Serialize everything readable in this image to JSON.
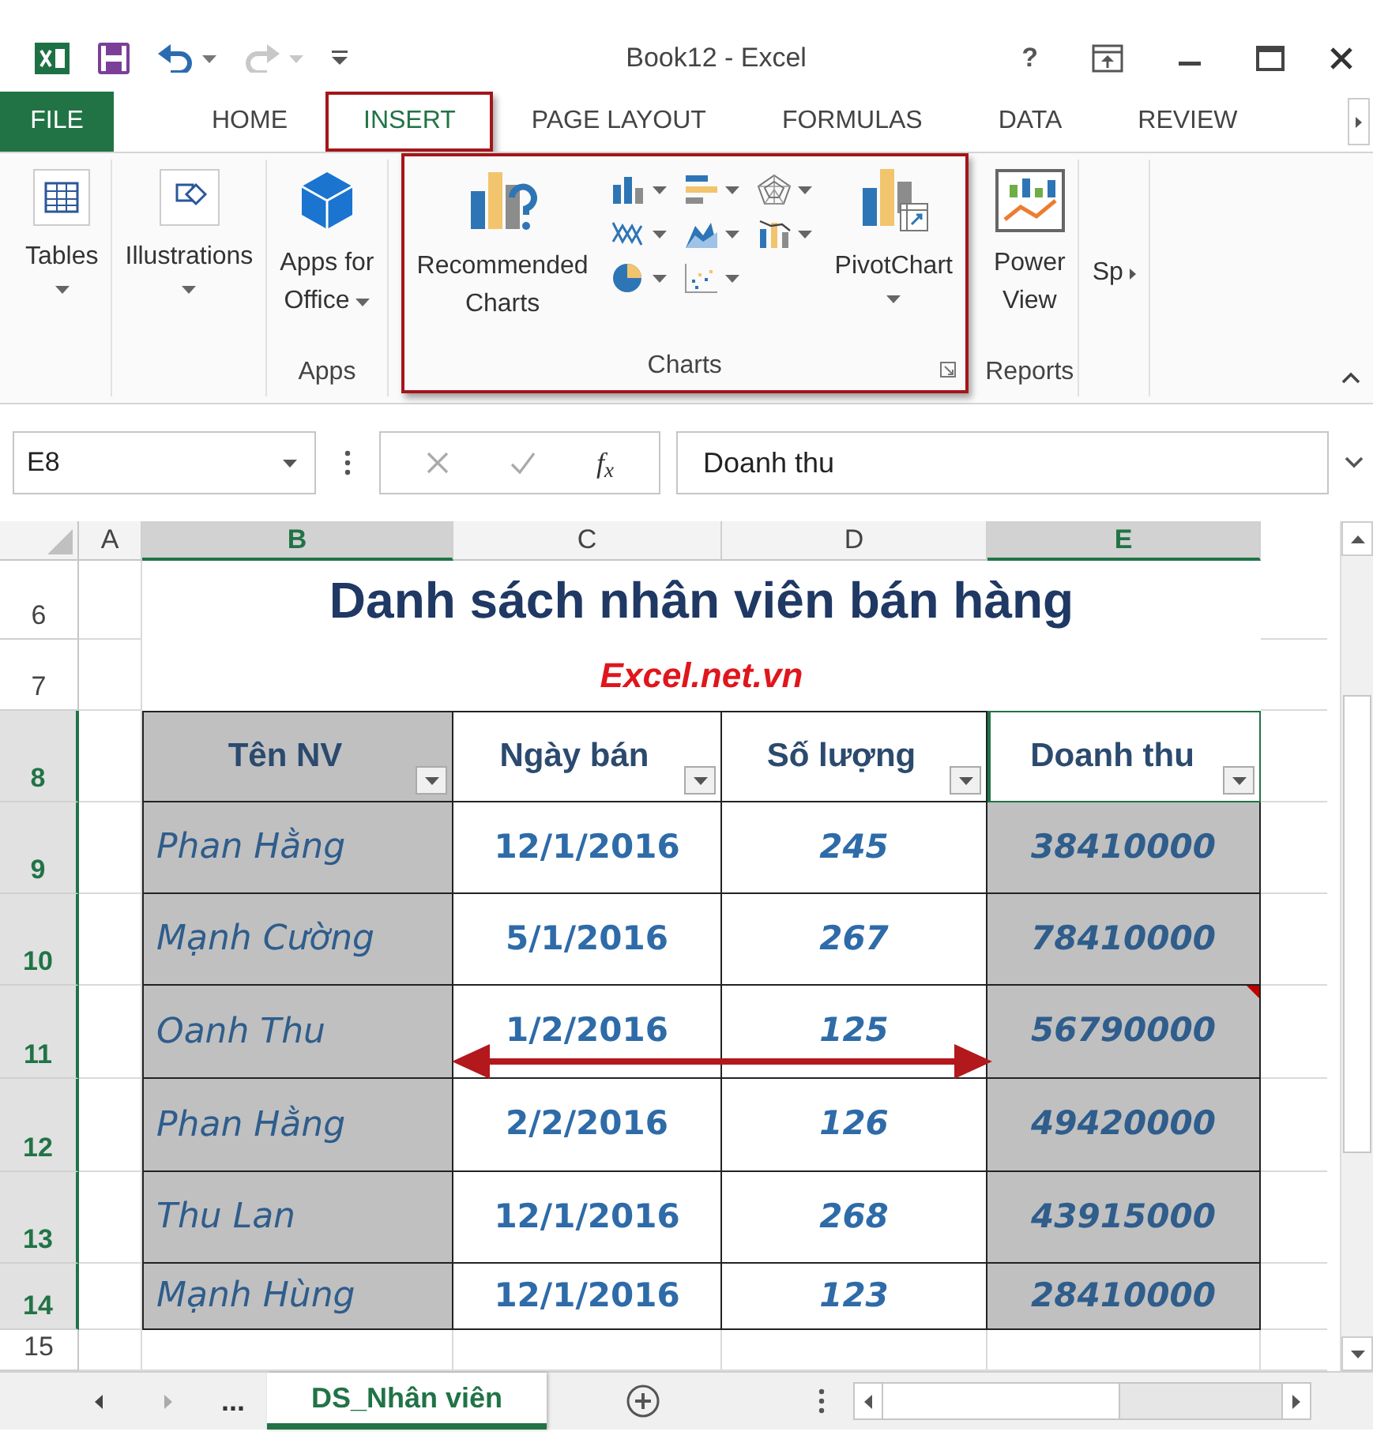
{
  "title_bar": {
    "title": "Book12 - Excel",
    "help": "?"
  },
  "ribbon_tabs": [
    {
      "label": "FILE",
      "kind": "file",
      "selected": false,
      "highlighted": false
    },
    {
      "label": "HOME",
      "kind": "tab",
      "selected": false,
      "highlighted": false
    },
    {
      "label": "INSERT",
      "kind": "tab",
      "selected": true,
      "highlighted": true
    },
    {
      "label": "PAGE LAYOUT",
      "kind": "tab",
      "selected": false,
      "highlighted": false
    },
    {
      "label": "FORMULAS",
      "kind": "tab",
      "selected": false,
      "highlighted": false
    },
    {
      "label": "DATA",
      "kind": "tab",
      "selected": false,
      "highlighted": false
    },
    {
      "label": "REVIEW",
      "kind": "tab",
      "selected": false,
      "highlighted": false
    }
  ],
  "ribbon_groups": [
    {
      "kind": "plain",
      "highlighted": false,
      "buttons": [
        {
          "lines": [
            "Tables"
          ],
          "kind": "below"
        }
      ]
    },
    {
      "kind": "plain",
      "highlighted": false,
      "buttons": [
        {
          "lines": [
            "Illustrations"
          ],
          "kind": "below"
        }
      ]
    },
    {
      "kind": "plain",
      "label": "Apps",
      "highlighted": false,
      "buttons": [
        {
          "lines": [
            "Apps for",
            "Office"
          ],
          "kind": "inline"
        }
      ]
    },
    {
      "kind": "charts",
      "label": "Charts",
      "highlighted": true,
      "buttons": [
        {
          "lines": [
            "Recommended",
            "Charts"
          ],
          "kind": "plain"
        },
        {
          "lines": [
            "PivotChart"
          ],
          "kind": "below"
        }
      ]
    },
    {
      "kind": "plain",
      "label": "Reports",
      "highlighted": false,
      "buttons": [
        {
          "lines": [
            "Power",
            "View"
          ],
          "kind": "plain"
        }
      ]
    },
    {
      "kind": "plain",
      "highlighted": false,
      "buttons": [
        {
          "lines": [
            "Sp"
          ],
          "kind": "side"
        }
      ]
    }
  ],
  "formula_bar": {
    "name_box": "E8",
    "function_symbol": "f$_{x}$",
    "formula": "Doanh thu"
  },
  "sheet": {
    "column_headers": [
      {
        "label": "A",
        "selected": false
      },
      {
        "label": "B",
        "selected": true
      },
      {
        "label": "C",
        "selected": false
      },
      {
        "label": "D",
        "selected": false
      },
      {
        "label": "E",
        "selected": true
      }
    ],
    "row_headers": [
      {
        "label": "6",
        "selected": false
      },
      {
        "label": "7",
        "selected": false
      },
      {
        "label": "8",
        "selected": true
      },
      {
        "label": "9",
        "selected": true
      },
      {
        "label": "10",
        "selected": true
      },
      {
        "label": "11",
        "selected": true
      },
      {
        "label": "12",
        "selected": true
      },
      {
        "label": "13",
        "selected": true
      },
      {
        "label": "14",
        "selected": true
      },
      {
        "label": "15",
        "selected": false
      }
    ],
    "title": "Danh sách nhân viên bán hàng",
    "subtitle": "Excel.net.vn",
    "table": {
      "columns": [
        {
          "label": "Tên NV",
          "kind": "name",
          "shaded": true,
          "active": false
        },
        {
          "label": "Ngày bán",
          "kind": "date",
          "shaded": false,
          "active": false
        },
        {
          "label": "Số lượng",
          "kind": "quantity",
          "shaded": false,
          "active": false
        },
        {
          "label": "Doanh thu",
          "kind": "money",
          "shaded": true,
          "active": true
        }
      ],
      "rows": [
        {
          "cells": [
            "Phan Hằng",
            "12/1/2016",
            "245",
            "38410000"
          ],
          "commented": false
        },
        {
          "cells": [
            "Mạnh Cường",
            "5/1/2016",
            "267",
            "78410000"
          ],
          "commented": false
        },
        {
          "cells": [
            "Oanh Thu",
            "1/2/2016",
            "125",
            "56790000"
          ],
          "commented": true
        },
        {
          "cells": [
            "Phan Hằng",
            "2/2/2016",
            "126",
            "49420000"
          ],
          "commented": false
        },
        {
          "cells": [
            "Thu Lan",
            "12/1/2016",
            "268",
            "43915000"
          ],
          "commented": false
        },
        {
          "cells": [
            "Mạnh Hùng",
            "12/1/2016",
            "123",
            "28410000"
          ],
          "commented": false
        }
      ]
    }
  },
  "sheet_tabs": {
    "more": "...",
    "tabs": [
      {
        "label": "DS_Nhân viên",
        "selected": true
      }
    ]
  }
}
